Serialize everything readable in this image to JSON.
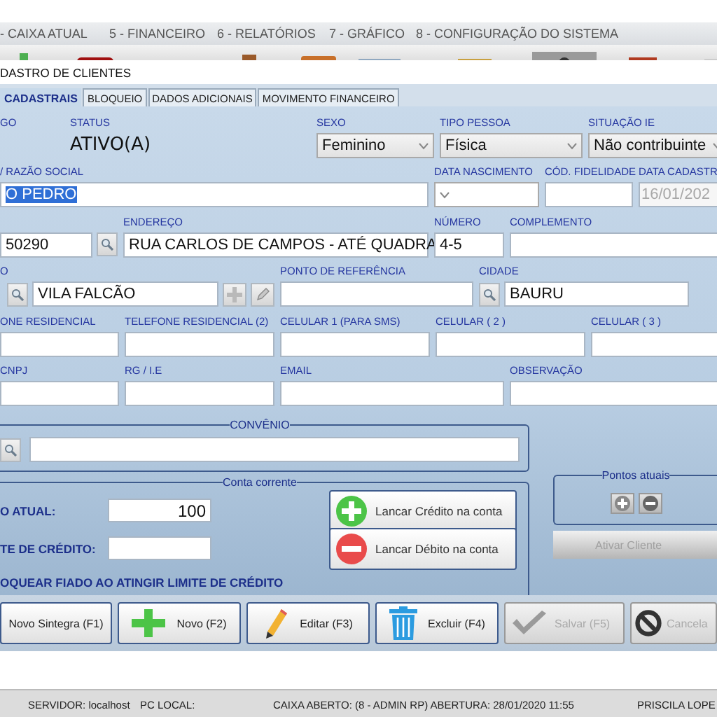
{
  "menu": [
    {
      "label": "- CAIXA ATUAL"
    },
    {
      "label": "5 - FINANCEIRO"
    },
    {
      "label": "6 - RELATÓRIOS"
    },
    {
      "label": "7 - GRÁFICO"
    },
    {
      "label": "8 - CONFIGURAÇÃO DO SISTEMA"
    }
  ],
  "window": {
    "title": "DASTRO DE CLIENTES"
  },
  "tabs": [
    {
      "label": "CADASTRAIS",
      "selected": true
    },
    {
      "label": "BLOQUEIO",
      "selected": false
    },
    {
      "label": "DADOS ADICIONAIS",
      "selected": false
    },
    {
      "label": "MOVIMENTO FINANCEIRO",
      "selected": false
    }
  ],
  "rows": [
    [
      {
        "kind": "static",
        "label": "GO"
      },
      {
        "kind": "static",
        "label": "STATUS",
        "value": "ATIVO(A)"
      },
      {
        "kind": "select",
        "label": "SEXO",
        "value": "Feminino"
      },
      {
        "kind": "select",
        "label": "TIPO PESSOA",
        "value": "Física"
      },
      {
        "kind": "select",
        "label": "SITUAÇÃO IE",
        "value": "Não contribuinte"
      }
    ],
    [
      {
        "kind": "text",
        "label": "/ RAZÃO SOCIAL",
        "value": "O PEDRO",
        "text_selected": true
      },
      {
        "kind": "select",
        "label": "DATA NASCIMENTO"
      },
      {
        "kind": "text",
        "label": "CÓD. FIDELIDADE"
      },
      {
        "kind": "text",
        "label": "DATA CADASTR",
        "value": "16/01/202",
        "disabled": true
      }
    ],
    [
      {
        "kind": "text_search",
        "value": "50290"
      },
      {
        "kind": "text",
        "label": "ENDEREÇO",
        "value": "RUA CARLOS DE CAMPOS - ATÉ QUADRA"
      },
      {
        "kind": "text",
        "label": "NÚMERO",
        "value": "4-5"
      },
      {
        "kind": "text",
        "label": "COMPLEMENTO"
      }
    ],
    [
      {
        "kind": "search_text_edit",
        "label": "O",
        "value": "VILA FALCÃO"
      },
      {
        "kind": "text",
        "label": "PONTO DE REFERÊNCIA"
      },
      {
        "kind": "search_text",
        "label": "CIDADE",
        "value": "BAURU"
      }
    ],
    [
      {
        "kind": "text",
        "label": "ONE RESIDENCIAL"
      },
      {
        "kind": "text",
        "label": "TELEFONE RESIDENCIAL (2)"
      },
      {
        "kind": "text",
        "label": "CELULAR 1 (PARA SMS)"
      },
      {
        "kind": "text",
        "label": "CELULAR ( 2 )"
      },
      {
        "kind": "text",
        "label": "CELULAR ( 3 )"
      }
    ],
    [
      {
        "kind": "text",
        "label": "CNPJ"
      },
      {
        "kind": "text",
        "label": "RG / I.E"
      },
      {
        "kind": "text",
        "label": "EMAIL"
      },
      {
        "kind": "text",
        "label": "OBSERVAÇÃO"
      }
    ]
  ],
  "convenio": {
    "title": "CONVÊNIO"
  },
  "conta_corrente": {
    "title": "Conta corrente",
    "saldo_label": "O ATUAL:",
    "saldo_value": "100",
    "limite_label": "TE DE CRÉDITO:",
    "bloquear_label": "OQUEAR FIADO AO ATINGIR LIMITE DE CRÉDITO",
    "buttons": [
      {
        "kind": "credit",
        "label": "Lancar Crédito na conta"
      },
      {
        "kind": "debit",
        "label": "Lancar Débito na conta"
      }
    ]
  },
  "pontos": {
    "title": "Pontos atuais",
    "activate_button": {
      "label": "Ativar Cliente",
      "disabled": true
    }
  },
  "actions": [
    {
      "kind": "none",
      "label": "Novo Sintegra (F1)",
      "disabled": false
    },
    {
      "kind": "add",
      "label": "Novo (F2)",
      "disabled": false
    },
    {
      "kind": "edit",
      "label": "Editar (F3)",
      "disabled": false
    },
    {
      "kind": "delete",
      "label": "Excluir (F4)",
      "disabled": false
    },
    {
      "kind": "save",
      "label": "Salvar (F5)",
      "disabled": true
    },
    {
      "kind": "cancel",
      "label": "Cancela",
      "disabled": true
    }
  ],
  "status_bar": [
    "SERVIDOR: localhost",
    "PC LOCAL:",
    "CAIXA ABERTO: (8 - ADMIN RP) ABERTURA: 28/01/2020 11:55",
    "PRISCILA LOPE"
  ]
}
